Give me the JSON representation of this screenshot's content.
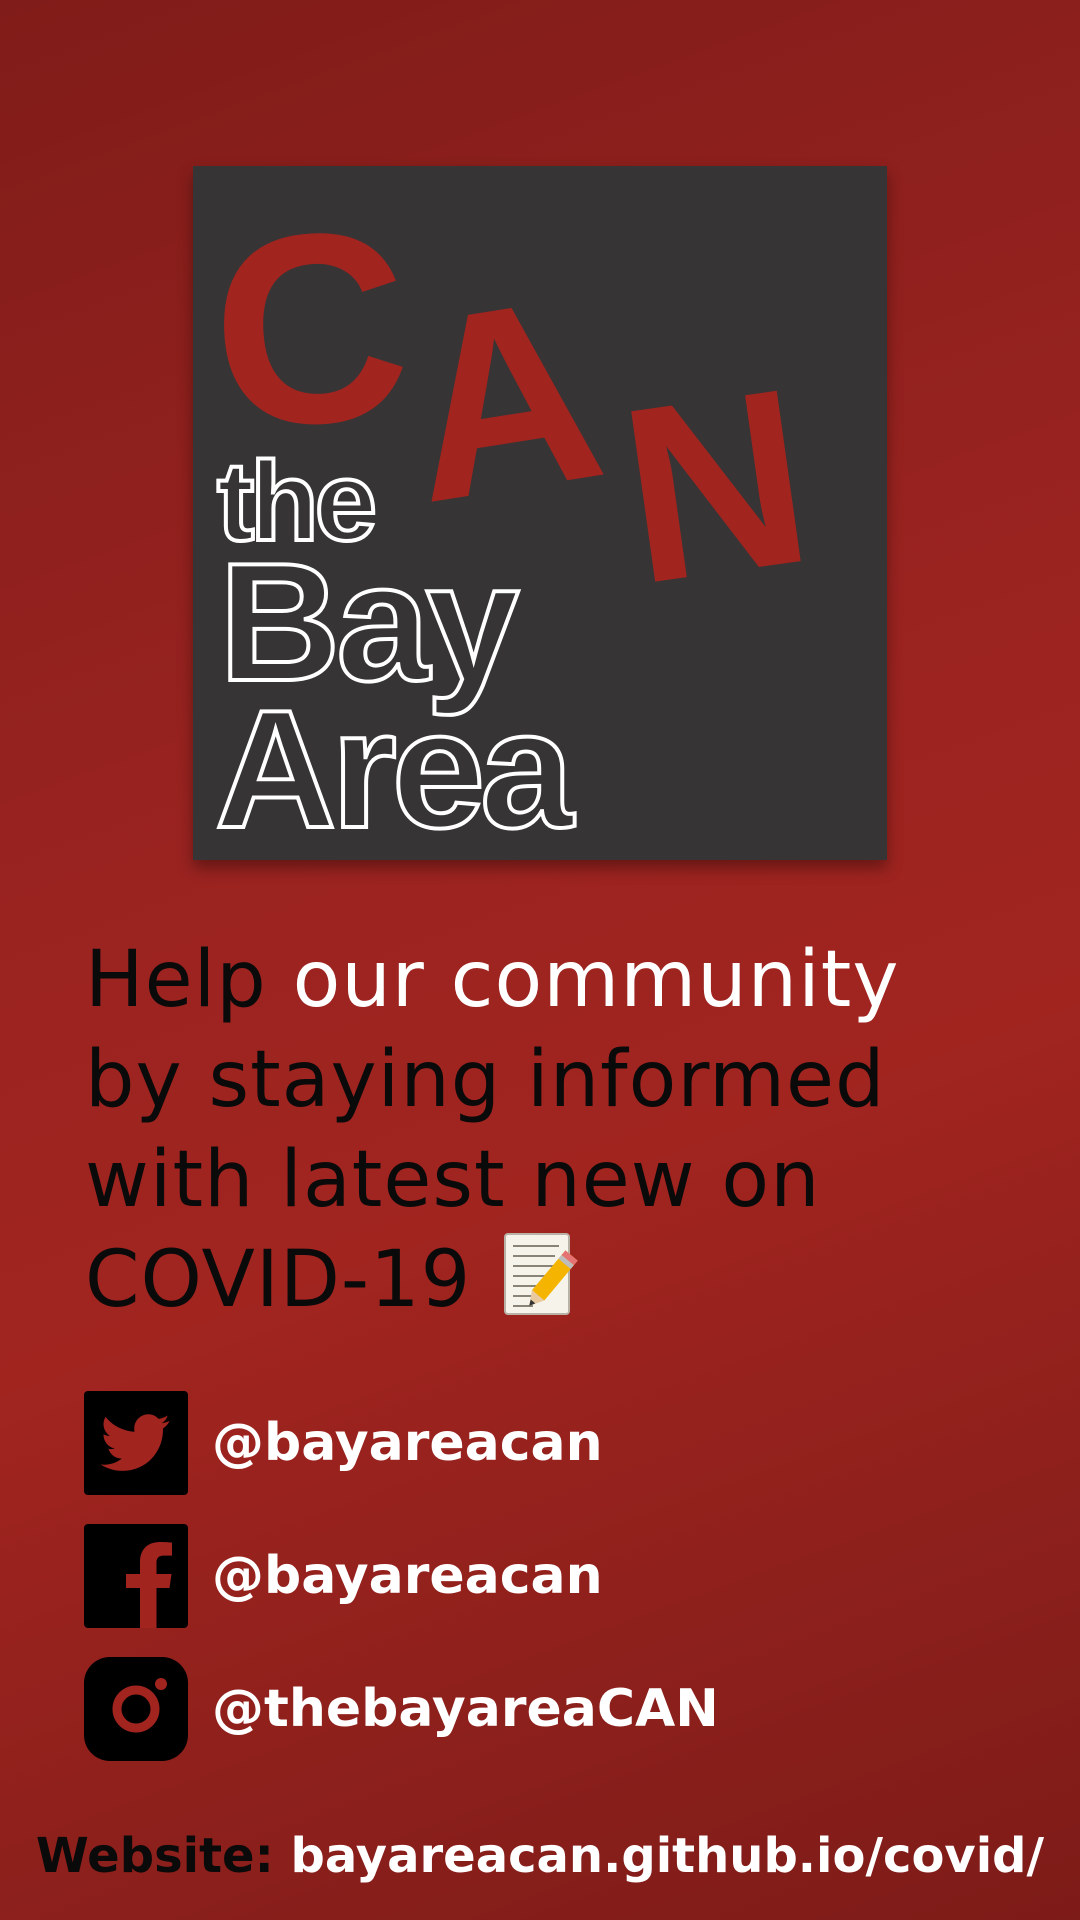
{
  "logo": {
    "can": [
      "C",
      "A",
      "N"
    ],
    "the": "the",
    "bay": "Bay",
    "area": "Area",
    "colors": {
      "background": "#363435",
      "red": "#a1241f",
      "outline": "#ffffff"
    }
  },
  "tagline": {
    "part1": "Help",
    "part2": "our community",
    "line2": "by staying informed",
    "line3": "with latest new on",
    "line4": "COVID-19",
    "emoji_icon": "memo-icon"
  },
  "social": [
    {
      "network": "twitter",
      "icon": "twitter-icon",
      "handle": "@bayareacan"
    },
    {
      "network": "facebook",
      "icon": "facebook-icon",
      "handle": "@bayareacan"
    },
    {
      "network": "instagram",
      "icon": "instagram-icon",
      "handle": "@thebayareaCAN"
    }
  ],
  "website": {
    "label": "Website:",
    "url": "bayareacan.github.io/covid/"
  },
  "colors": {
    "background": "#9a2320",
    "text_dark": "#0a0a0a",
    "text_light": "#ffffff"
  }
}
